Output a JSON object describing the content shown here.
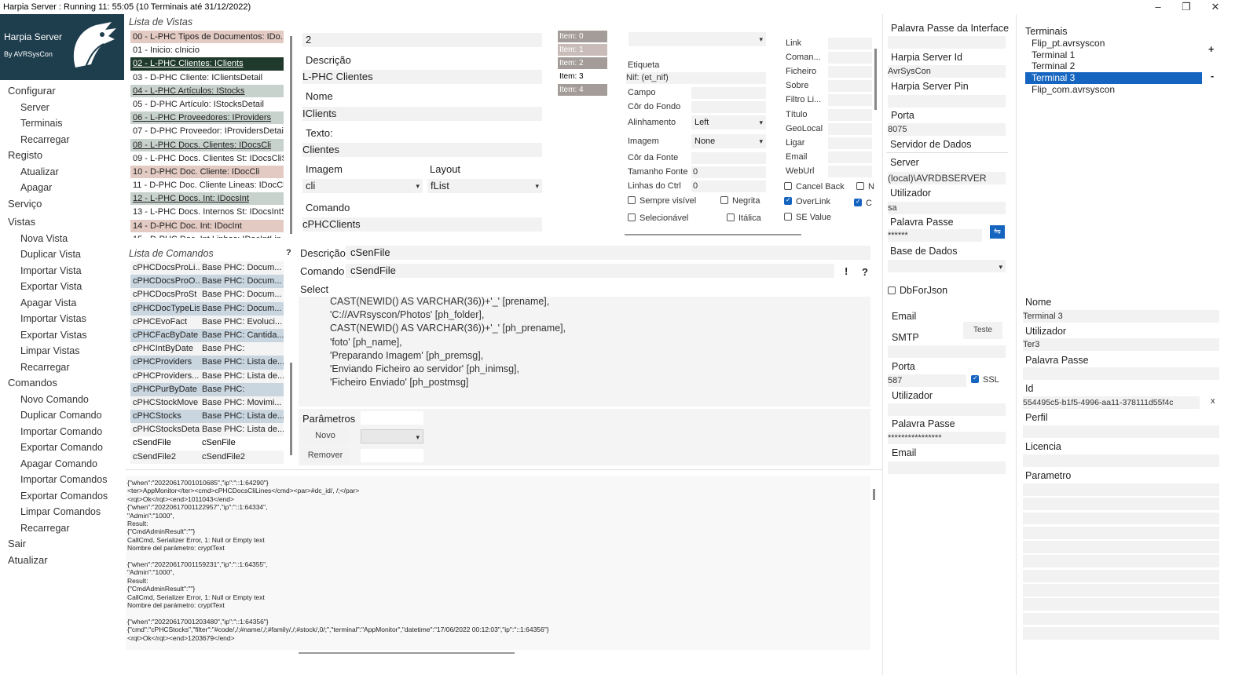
{
  "window": {
    "title": "Harpia Server : Running 11: 55:05 (10 Terminais até 31/12/2022)",
    "min": "–",
    "max": "❐",
    "close": "✕"
  },
  "logo": {
    "title": "Harpia Server",
    "subtitle": "By AVRSysCon"
  },
  "menu": [
    {
      "label": "Configurar",
      "type": "h"
    },
    {
      "label": "Server",
      "type": "s"
    },
    {
      "label": "Terminais",
      "type": "s"
    },
    {
      "label": "Recarregar",
      "type": "s"
    },
    {
      "label": "Registo",
      "type": "h"
    },
    {
      "label": "Atualizar",
      "type": "s"
    },
    {
      "label": "Apagar",
      "type": "s"
    },
    {
      "label": "Serviço",
      "type": "h"
    },
    {
      "label": "Vistas",
      "type": "h"
    },
    {
      "label": "Nova Vista",
      "type": "s"
    },
    {
      "label": "Duplicar Vista",
      "type": "s"
    },
    {
      "label": "Importar Vista",
      "type": "s"
    },
    {
      "label": "Exportar Vista",
      "type": "s"
    },
    {
      "label": "Apagar Vista",
      "type": "s"
    },
    {
      "label": "Importar Vistas",
      "type": "s"
    },
    {
      "label": "Exportar Vistas",
      "type": "s"
    },
    {
      "label": "Limpar Vistas",
      "type": "s"
    },
    {
      "label": "Recarregar",
      "type": "s"
    },
    {
      "label": "Comandos",
      "type": "h"
    },
    {
      "label": "Novo Comando",
      "type": "s"
    },
    {
      "label": "Duplicar Comando",
      "type": "s"
    },
    {
      "label": "Importar Comando",
      "type": "s"
    },
    {
      "label": "Exportar Comando",
      "type": "s"
    },
    {
      "label": "Apagar Comando",
      "type": "s"
    },
    {
      "label": "Importar Comandos",
      "type": "s"
    },
    {
      "label": "Exportar Comandos",
      "type": "s"
    },
    {
      "label": "Limpar Comandos",
      "type": "s"
    },
    {
      "label": "Recarregar",
      "type": "s"
    },
    {
      "label": "Sair",
      "type": "h"
    },
    {
      "label": "Atualizar",
      "type": "h"
    }
  ],
  "views": {
    "title": "Lista de Vistas",
    "items": [
      {
        "label": "00 - L-PHC Tipos de Documentos: IDo...",
        "style": "p"
      },
      {
        "label": "01 - Inicio: cInicio",
        "style": "w"
      },
      {
        "label": "02 - L-PHC Clientes: IClients",
        "style": "s"
      },
      {
        "label": "03 - D-PHC Cliente: IClientsDetail",
        "style": "w"
      },
      {
        "label": "04 - L-PHC Artículos: IStocks",
        "style": "g"
      },
      {
        "label": "05 - D-PHC Artículo: IStocksDetail",
        "style": "w"
      },
      {
        "label": "06 - L-PHC Proveedores: IProviders",
        "style": "g"
      },
      {
        "label": "07 - D-PHC Proveedor: IProvidersDetail",
        "style": "w"
      },
      {
        "label": "08 - L-PHC Docs. Clientes: IDocsCli",
        "style": "g"
      },
      {
        "label": "09 - L-PHC Docs. Clientes St: IDocsCliSt",
        "style": "w"
      },
      {
        "label": "10 - D-PHC Doc. Cliente: IDocCli",
        "style": "p"
      },
      {
        "label": "11 - D-PHC Doc. Cliente Lineas: IDocCl...",
        "style": "w"
      },
      {
        "label": "12 - L-PHC Docs. Int: IDocsInt",
        "style": "g"
      },
      {
        "label": "13 - L-PHC Docs. Internos St: IDocsIntSt",
        "style": "w"
      },
      {
        "label": "14 - D-PHC Doc. Int: IDocInt",
        "style": "p"
      },
      {
        "label": "15 - D-PHC Doc. Int Linhas: IDocIntLin",
        "style": "w"
      }
    ]
  },
  "view": {
    "num": "2",
    "desc_label": "Descrição",
    "desc_value": "L-PHC Clientes",
    "name_label": "Nome",
    "name_value": "IClients",
    "text_label": "Texto:",
    "text_value": "Clientes",
    "image_label": "Imagem",
    "image_value": "cli",
    "layout_label": "Layout",
    "layout_value": "fList",
    "cmd_label": "Comando",
    "cmd_value": "cPHCClients"
  },
  "items": [
    "Item: 0",
    "Item: 1",
    "Item: 2",
    "Item: 3",
    "Item: 4"
  ],
  "props": {
    "etiqueta": "Etiqueta",
    "nif": "Nif: (et_nif)",
    "campo": "Campo",
    "fundo": "Côr do Fondo",
    "alinhamento": "Alinhamento",
    "alinhamento_val": "Left",
    "imagem": "Imagem",
    "imagem_val": "None",
    "fonte": "Côr da Fonte",
    "tamanho": "Tamanho Fonte",
    "tamanho_val": "0",
    "linhas": "Linhas do Ctrl",
    "linhas_val": "0",
    "sempre": "Sempre visível",
    "negrita": "Negrita",
    "selec": "Selecionável",
    "italica": "Itálica"
  },
  "props2": {
    "link": "Link",
    "coman": "Coman...",
    "ficheiro": "Ficheiro",
    "sobre": "Sobre",
    "filtro": "Filtro Li...",
    "titulo": "Título",
    "geo": "GeoLocal",
    "ligar": "Ligar",
    "email": "Email",
    "web": "WebUrl",
    "cancel": "Cancel Back",
    "overlink": "OverLink",
    "sevalue": "SE Value",
    "n": "N",
    "c": "C"
  },
  "commands": {
    "title": "Lista de Comandos",
    "help": "?",
    "rows": [
      [
        "cPHCDocsProLi...",
        "Base PHC: Docum...",
        "w"
      ],
      [
        "cPHCDocsProO...",
        "Base PHC: Docum...",
        "b"
      ],
      [
        "cPHCDocsProSt",
        "Base PHC: Docum...",
        "w"
      ],
      [
        "cPHCDocTypeList",
        "Base PHC: Docum...",
        "b"
      ],
      [
        "cPHCEvoFact",
        "Base PHC: Evoluci...",
        "w"
      ],
      [
        "cPHCFacByDate",
        "Base PHC: Cantida...",
        "b"
      ],
      [
        "cPHCIntByDate",
        "Base PHC:",
        "w"
      ],
      [
        "cPHCProviders",
        "Base PHC: Lista de...",
        "b"
      ],
      [
        "cPHCProviders...",
        "Base PHC: Lista de...",
        "w"
      ],
      [
        "cPHCPurByDate",
        "Base PHC:",
        "b"
      ],
      [
        "cPHCStockMove",
        "Base PHC: Movimi...",
        "w"
      ],
      [
        "cPHCStocks",
        "Base PHC: Lista de...",
        "b"
      ],
      [
        "cPHCStocksDetail",
        "Base PHC: Lista de...",
        "w"
      ],
      [
        "cSendFile",
        "cSenFile",
        "x"
      ],
      [
        "cSendFile2",
        "cSendFile2",
        "w"
      ]
    ]
  },
  "cmd": {
    "desc_label": "Descrição",
    "desc_value": "cSenFile",
    "cmd_label": "Comando",
    "cmd_value": "cSendFile",
    "excl": "!",
    "help": "?",
    "select_label": "Select",
    "sql": [
      "CAST(NEWID() AS VARCHAR(36))+'_' [prename],",
      "'C://AVRsyscon/Photos' [ph_folder],",
      "CAST(NEWID() AS VARCHAR(36))+'_' [ph_prename],",
      "'foto' [ph_name],",
      "'Preparando Imagem' [ph_premsg],",
      "'Enviando Ficheiro ao servidor' [ph_inimsg],",
      "'Ficheiro Enviado' [ph_postmsg]"
    ],
    "params_label": "Parâmetros",
    "novo": "Novo",
    "remover": "Remover"
  },
  "log": [
    "{\"when\":\"20220617001010685\",\"ip\":\"::1:64290\"}",
    "<ter>AppMonitor</ter><cmd>cPHCDocsCliLines</cmd><par>#dc_id/, /;</par>",
    "<rqt>Ok</rqt><end>1011043</end>",
    "{\"when\":\"20220617001122957\",\"ip\":\"::1:64334\",",
    "\"Admin\":\"1000\",",
    "Result:",
    "{\"CmdAdminResult\":\"\"}",
    "CallCmd, Serializer Error, 1: Null or Empty text",
    "Nombre del parámetro: cryptText",
    "",
    "{\"when\":\"20220617001159231\",\"ip\":\"::1:64355\",",
    "\"Admin\":\"1000\",",
    "Result:",
    "{\"CmdAdminResult\":\"\"}",
    "CallCmd, Serializer Error, 1: Null or Empty text",
    "Nombre del parámetro: cryptText",
    "",
    "{\"when\":\"20220617001203480\",\"ip\":\"::1:64356\"}",
    "{\"cmd\":\"cPHCStocks\",\"filter\":\"#code/,/;#name/,/;#family/,/;#stock/,0/;\",\"terminal\":\"AppMonitor\",\"datetime\":\"17/06/2022 00:12:03\",\"ip\":\"::1:64356\"}",
    "<rqt>Ok</rqt><end>1203679</end>"
  ],
  "server": {
    "pp_iface": "Palavra Passe da Interface",
    "id_label": "Harpia Server Id",
    "id_value": "AvrSysCon",
    "pin_label": "Harpia Server Pin",
    "porta_label": "Porta",
    "porta_value": "8075",
    "dados": "Servidor de Dados",
    "server_label": "Server",
    "server_value": "(local)\\AVRDBSERVER",
    "user_label": "Utilizador",
    "user_value": "sa",
    "pass_label": "Palavra Passe",
    "pass_value": "******",
    "bd_label": "Base de Dados",
    "dbjson": "DbForJson",
    "email": "Email",
    "smtp": "SMTP",
    "teste": "Teste",
    "porta2": "Porta",
    "porta2_value": "587",
    "ssl": "SSL",
    "user2": "Utilizador",
    "pass2": "Palavra Passe",
    "pass2_value": "****************",
    "email2": "Email"
  },
  "terminals": {
    "title": "Terminais",
    "items": [
      "Flip_pt.avrsyscon",
      "Terminal 1",
      "Terminal 2",
      "Terminal 3",
      "Flip_com.avrsyscon"
    ],
    "selected": 3,
    "add": "+",
    "remove": "-",
    "nome_label": "Nome",
    "nome_value": "Terminal 3",
    "user_label": "Utilizador",
    "user_value": "Ter3",
    "pass_label": "Palavra Passe",
    "id_label": "Id",
    "id_value": "554495c5-b1f5-4996-aa11-378111d55f4c",
    "x": "x",
    "perfil": "Perfil",
    "licencia": "Licencia",
    "parametro": "Parametro"
  }
}
